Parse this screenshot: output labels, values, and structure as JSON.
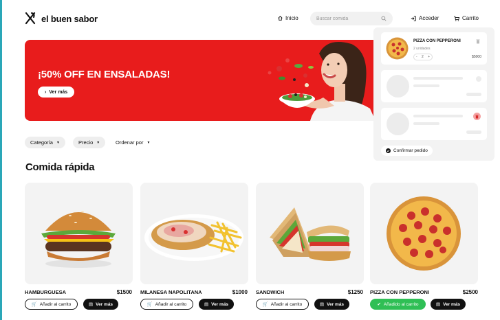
{
  "header": {
    "brand": "el buen sabor",
    "nav_home": "Inicio",
    "search_placeholder": "Buscar comida",
    "login": "Acceder",
    "cart": "Carrito"
  },
  "banner": {
    "headline": "¡50% OFF EN ENSALADAS!",
    "cta": "Ver más"
  },
  "filters": {
    "category": "Categoría",
    "price": "Precio",
    "sort": "Ordenar por"
  },
  "section": {
    "title": "Comida rápida"
  },
  "products": [
    {
      "name": "HAMBURGUESA",
      "price": "$1500",
      "add_label": "Añadir al carrito",
      "more_label": "Ver más"
    },
    {
      "name": "MILANESA NAPOLITANA",
      "price": "$1000",
      "add_label": "Añadir al carrito",
      "more_label": "Ver más"
    },
    {
      "name": "SANDWICH",
      "price": "$1250",
      "add_label": "Añadir al carrito",
      "more_label": "Ver más"
    },
    {
      "name": "PIZZA CON PEPPERONI",
      "price": "$2500",
      "add_label": "Añadido al carrito",
      "more_label": "Ver más"
    }
  ],
  "cart_panel": {
    "item": {
      "name": "PIZZA CON PEPPERONI",
      "units": "2 unidades",
      "minus": "-",
      "quantity": "2",
      "plus": "+",
      "price": "$5000"
    },
    "confirm": "Confirmar pedido"
  },
  "colors": {
    "brand_red": "#e81c1c",
    "added_green": "#2fbf55",
    "dark": "#111111"
  }
}
